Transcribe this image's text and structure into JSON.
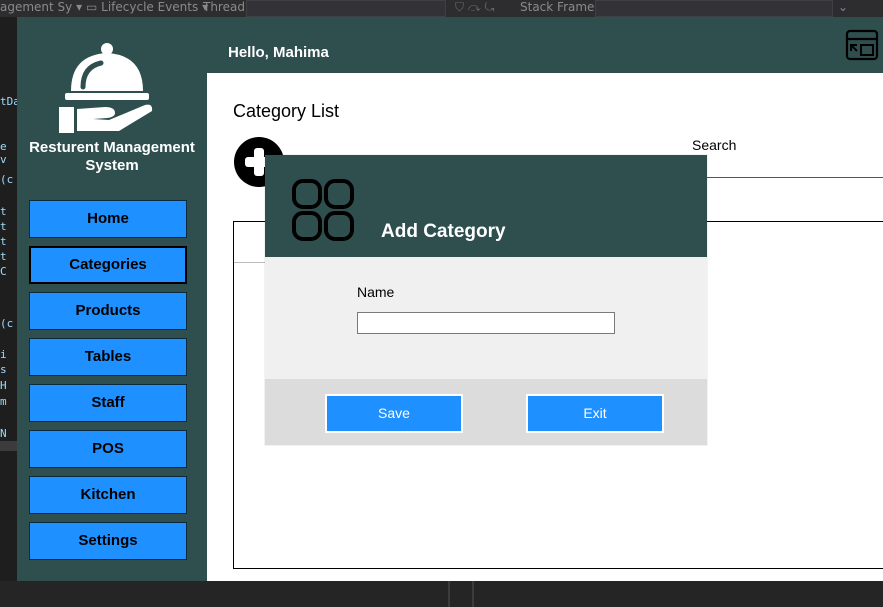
{
  "ide": {
    "toolbar": {
      "project_dropdown": "agement Sy",
      "lifecycle_events": "Lifecycle Events",
      "thread_label": "Thread:",
      "stack_frame_label": "Stack Frame:"
    },
    "gutter_fragments": [
      "tDa",
      "e v",
      "(c",
      "t",
      "t",
      "t",
      "t",
      "C",
      "(c",
      "i",
      "s",
      "H",
      "m",
      "N"
    ]
  },
  "app": {
    "name": "Resturent Management System",
    "greeting": "Hello, Mahima",
    "nav": [
      {
        "label": "Home"
      },
      {
        "label": "Categories"
      },
      {
        "label": "Products"
      },
      {
        "label": "Tables"
      },
      {
        "label": "Staff"
      },
      {
        "label": "POS"
      },
      {
        "label": "Kitchen"
      },
      {
        "label": "Settings"
      }
    ],
    "active_nav": "Categories",
    "colors": {
      "sidebar": "#2f4f4f",
      "button": "#1e90ff"
    }
  },
  "main": {
    "title": "Category List",
    "search_label": "Search",
    "search_value": ""
  },
  "modal": {
    "title": "Add Category",
    "name_label": "Name",
    "name_value": "",
    "save_label": "Save",
    "exit_label": "Exit"
  },
  "icons": {
    "logo": "cloche-serving-hand-icon",
    "corner": "window-restore-icon",
    "add": "plus-circle-icon",
    "modal": "category-grid-icon"
  }
}
